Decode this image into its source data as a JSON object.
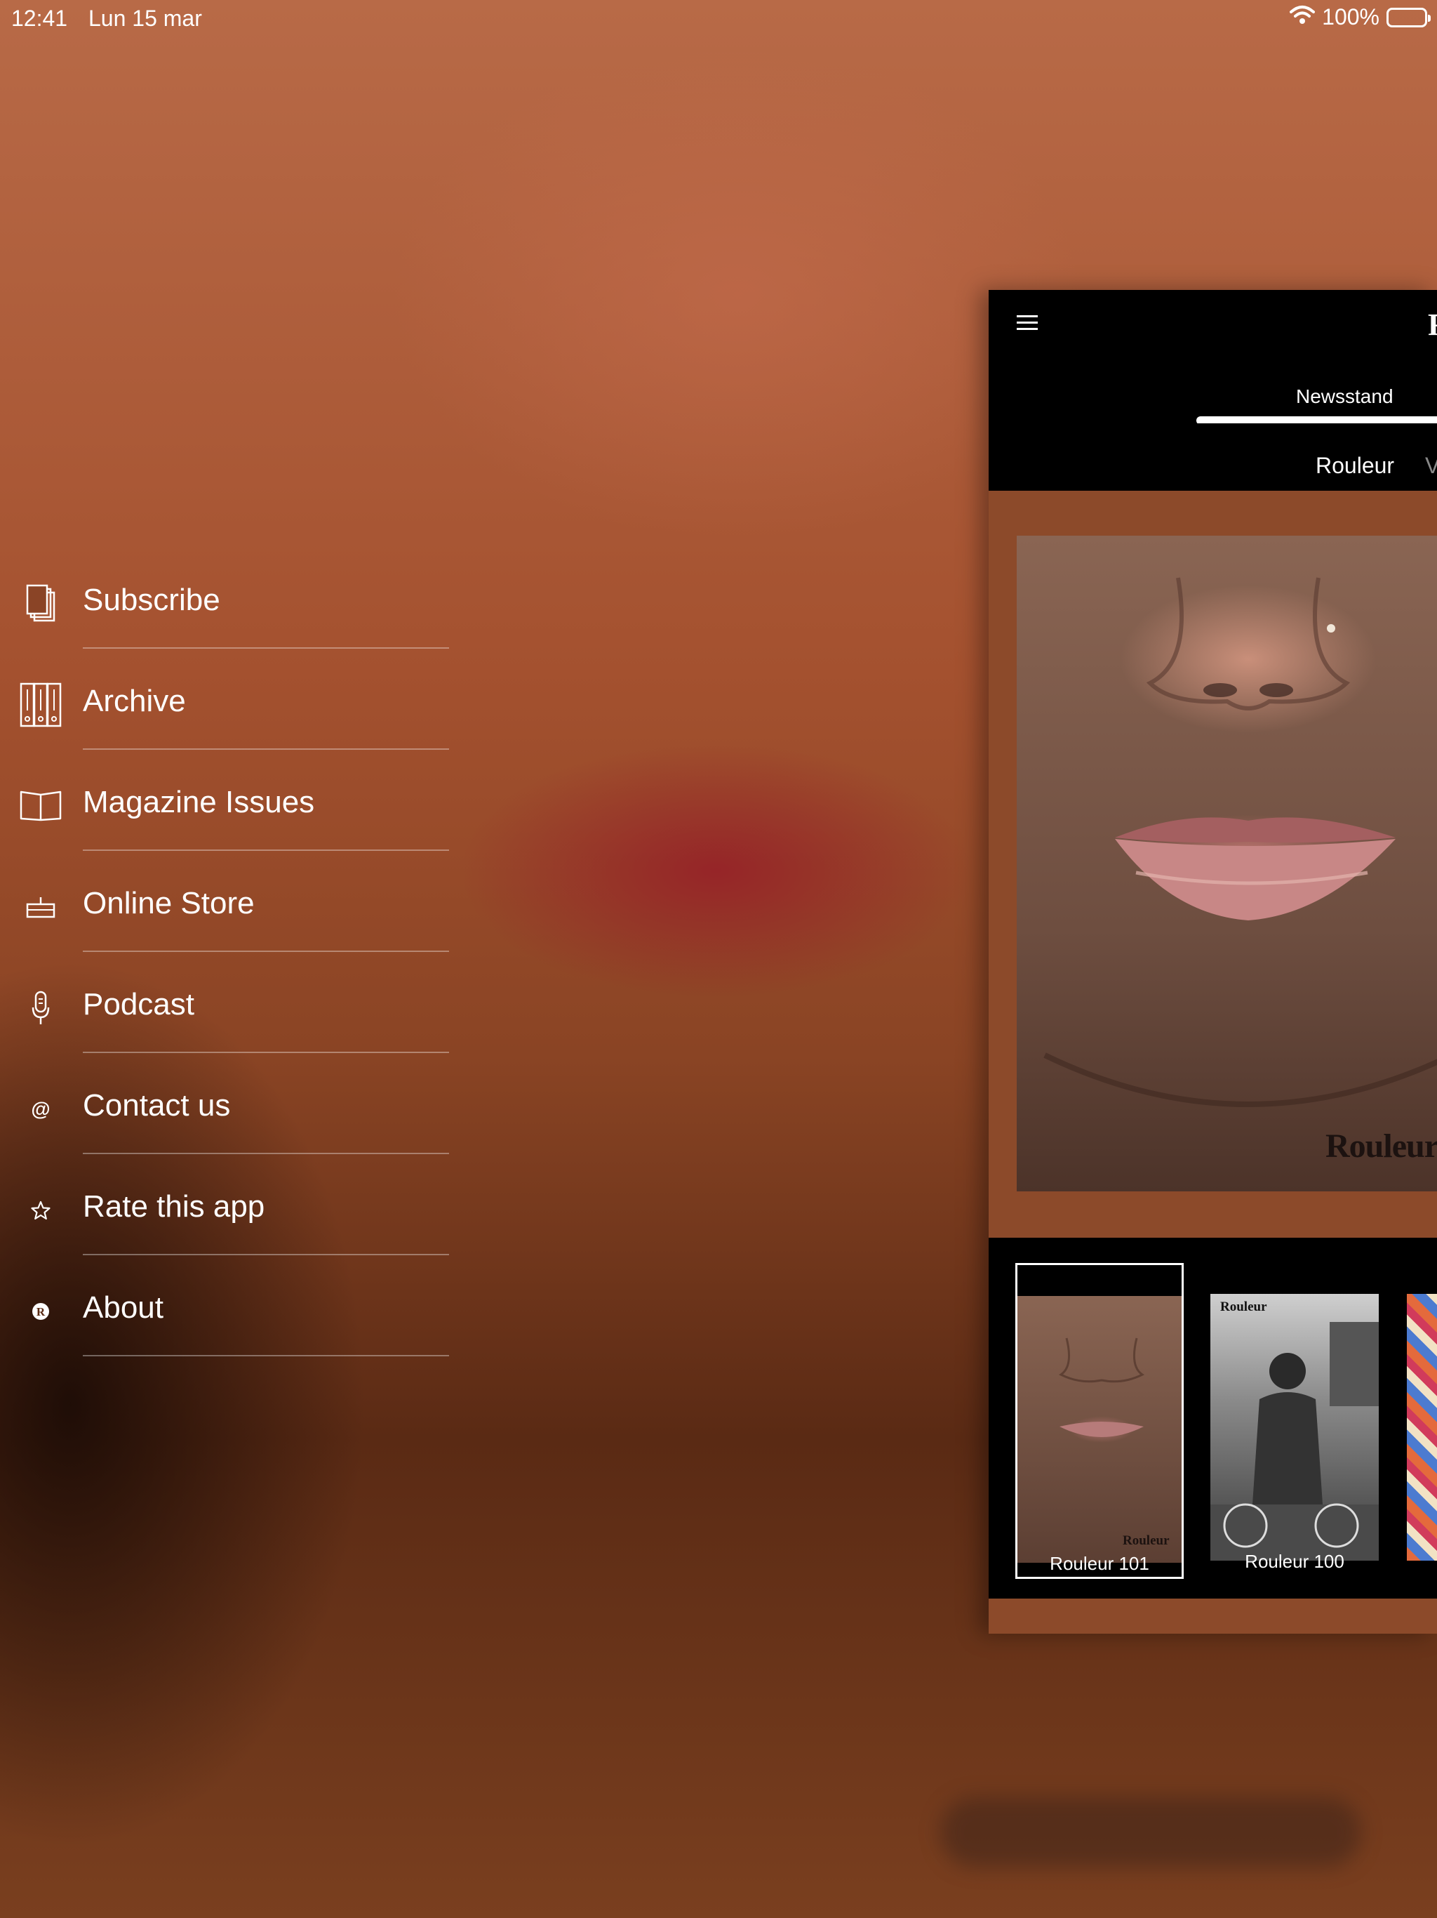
{
  "status_bar": {
    "time": "12:41",
    "date": "Lun 15 mar",
    "battery": "100%"
  },
  "menu": [
    {
      "label": "Subscribe",
      "icon": "subscribe-pages-icon"
    },
    {
      "label": "Archive",
      "icon": "archive-binders-icon"
    },
    {
      "label": "Magazine Issues",
      "icon": "open-book-icon"
    },
    {
      "label": "Online Store",
      "icon": "basket-icon"
    },
    {
      "label": "Podcast",
      "icon": "microphone-icon"
    },
    {
      "label": "Contact us",
      "icon": "at-sign-icon"
    },
    {
      "label": "Rate this app",
      "icon": "star-icon"
    },
    {
      "label": "About",
      "icon": "rouleur-logo-icon"
    }
  ],
  "panel": {
    "brand_glyph": "R",
    "tab": "Newsstand",
    "subnav": [
      "Rouleur",
      "V"
    ],
    "cover_logo": "Rouleur",
    "thumbs": [
      {
        "label": "Rouleur 101",
        "logo": "Rouleur",
        "selected": true
      },
      {
        "label": "Rouleur 100",
        "logo": "Rouleur",
        "selected": false
      }
    ]
  }
}
